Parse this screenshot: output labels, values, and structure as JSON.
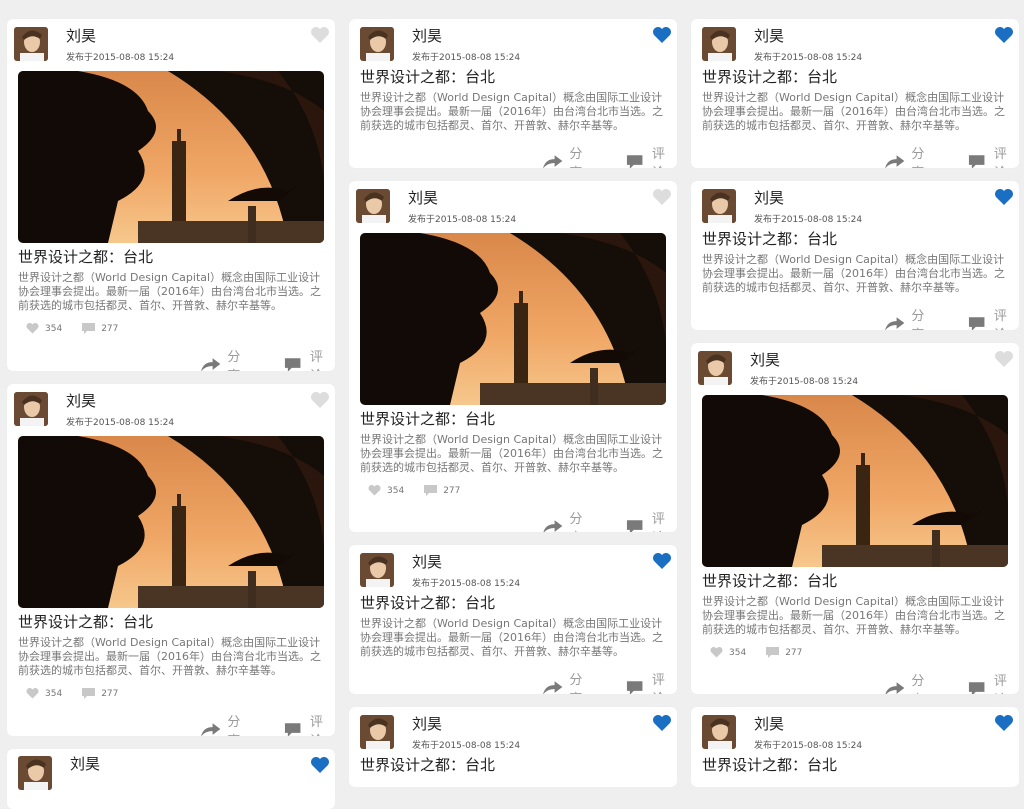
{
  "post": {
    "author": "刘昊",
    "date": "发布于2015-08-08  15:24",
    "title": "世界设计之都：台北",
    "description": "世界设计之都（World Design Capital）概念由国际工业设计协会理事会提出。最新一届（2016年）由台湾台北市当选。之前获选的城市包括都灵、首尔、开普敦、赫尔辛基等。",
    "likes": "354",
    "comments": "277",
    "share_label": "分享",
    "comment_label": "评论"
  },
  "colors": {
    "liked_heart": "#1a6fc2",
    "unliked_heart": "#dddddd",
    "background": "#efefef"
  }
}
